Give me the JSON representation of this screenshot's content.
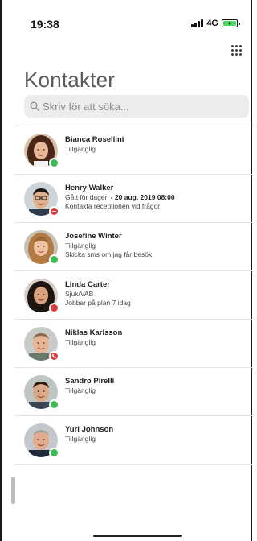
{
  "status_bar": {
    "time": "19:38",
    "network": "4G",
    "battery_charging": true
  },
  "header": {
    "title": "Kontakter",
    "keypad_icon": "dialpad-icon"
  },
  "search": {
    "placeholder": "Skriv för att söka...",
    "value": ""
  },
  "colors": {
    "available": "#3cba54",
    "busy": "#e03a3a",
    "title": "#5a5a5a"
  },
  "contacts": [
    {
      "name": "Bianca Rosellini",
      "status": "Tillgänglig",
      "status_icon": "available",
      "lines": []
    },
    {
      "name": "Henry Walker",
      "status": "Gått för dagen",
      "status_extra": "- 20 aug. 2019 08:00",
      "status_icon": "do-not-disturb",
      "lines": [
        "Kontakta receptionen vid frågor"
      ]
    },
    {
      "name": "Josefine Winter",
      "status": "Tillgänglig",
      "status_icon": "available",
      "lines": [
        "Skicka sms om jag får besök"
      ]
    },
    {
      "name": "Linda Carter",
      "status": "Sjuk/VAB",
      "status_icon": "do-not-disturb",
      "lines": [
        "Jobbar på plan 7 idag"
      ]
    },
    {
      "name": "Niklas Karlsson",
      "status": "Tillgänglig",
      "status_icon": "on-call",
      "lines": []
    },
    {
      "name": "Sandro Pirelli",
      "status": "Tillgänglig",
      "status_icon": "available",
      "lines": []
    },
    {
      "name": "Yuri Johnson",
      "status": "Tillgänglig",
      "status_icon": "available",
      "lines": []
    }
  ]
}
